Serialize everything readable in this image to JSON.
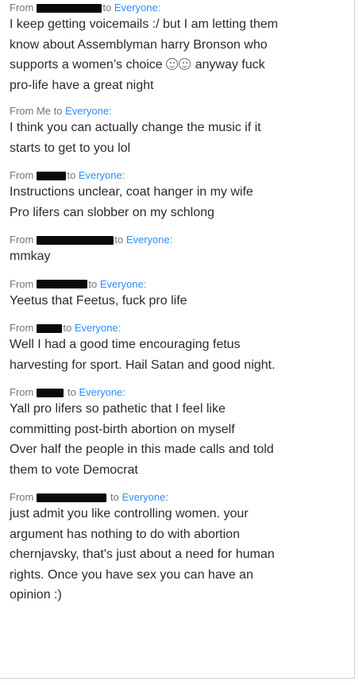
{
  "labels": {
    "from": "From",
    "to": "to",
    "everyone": "Everyone:",
    "me": "Me"
  },
  "messages": [
    {
      "sender": "redacted",
      "lines": [
        "I keep getting voicemails :/ but I am letting them",
        "know about Assemblyman harry Bronson who",
        "supports a women’s choice",
        " anyway fuck",
        "pro-life have a great night"
      ],
      "emoji": [
        "smiling-face-icon",
        "smiling-face-icon"
      ]
    },
    {
      "sender": "Me",
      "lines": [
        "I think you can actually change the music if it",
        "starts to get to you lol"
      ]
    },
    {
      "sender": "redacted",
      "lines": [
        "Instructions unclear, coat hanger in my wife",
        "Pro lifers can slobber on my schlong"
      ]
    },
    {
      "sender": "redacted",
      "lines": [
        "mmkay"
      ]
    },
    {
      "sender": "redacted",
      "lines": [
        "Yeetus that Feetus, fuck pro life"
      ]
    },
    {
      "sender": "redacted",
      "lines": [
        "Well I had a good time encouraging fetus",
        "harvesting for sport. Hail Satan and good night."
      ]
    },
    {
      "sender": "redacted",
      "lines": [
        "Yall pro lifers so pathetic that I feel like",
        "committing post-birth abortion on myself",
        "Over half the people in this made calls and told",
        "them to vote Democrat"
      ]
    },
    {
      "sender": "redacted",
      "lines": [
        "just admit you like controlling women. your",
        "argument has nothing to do with abortion",
        "chernjavsky, that's just about a need for human",
        "rights. Once you have sex you can have an",
        "opinion :)"
      ]
    }
  ]
}
